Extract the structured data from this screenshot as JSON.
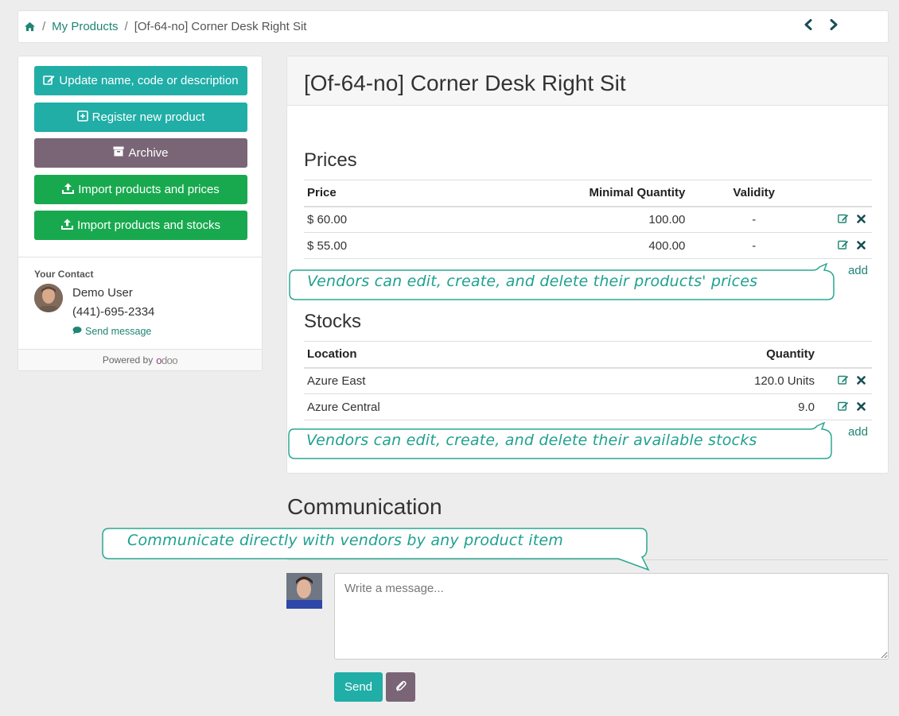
{
  "breadcrumb": {
    "home_icon": "home-icon",
    "items": [
      "My Products",
      "[Of-64-no] Corner Desk Right Sit"
    ],
    "separator": "/",
    "prev_icon": "chevron-left-icon",
    "next_icon": "chevron-right-icon"
  },
  "sidebar": {
    "buttons": [
      {
        "label": "Update name, code or description",
        "icon": "edit-icon",
        "color": "#20aea7"
      },
      {
        "label": "Register new product",
        "icon": "plus-square-icon",
        "color": "#20aea7"
      },
      {
        "label": "Archive",
        "icon": "archive-icon",
        "color": "#7a6577"
      },
      {
        "label": "Import products and prices",
        "icon": "upload-icon",
        "color": "#18a94f"
      },
      {
        "label": "Import products and stocks",
        "icon": "upload-icon",
        "color": "#18a94f"
      }
    ],
    "contact": {
      "label": "Your Contact",
      "name": "Demo User",
      "phone": "(441)-695-2334",
      "send_message": "Send message"
    },
    "powered_by": "Powered by",
    "logo_text": "odoo"
  },
  "product": {
    "title": "[Of-64-no] Corner Desk Right Sit"
  },
  "prices": {
    "title": "Prices",
    "columns": [
      "Price",
      "Minimal Quantity",
      "Validity"
    ],
    "rows": [
      {
        "price": "$ 60.00",
        "min_qty": "100.00",
        "validity": "-"
      },
      {
        "price": "$ 55.00",
        "min_qty": "400.00",
        "validity": "-"
      }
    ],
    "add_label": "add",
    "callout": "Vendors can edit, create, and delete their products' prices"
  },
  "stocks": {
    "title": "Stocks",
    "columns": [
      "Location",
      "Quantity"
    ],
    "rows": [
      {
        "location": "Azure East",
        "quantity": "120.0 Units"
      },
      {
        "location": "Azure Central",
        "quantity": "9.0"
      }
    ],
    "add_label": "add",
    "callout": "Vendors can edit, create, and delete their available stocks"
  },
  "communication": {
    "title": "Communication",
    "callout": "Communicate directly with vendors by any product item",
    "placeholder": "Write a message...",
    "send_label": "Send",
    "attach_icon": "paperclip-icon"
  },
  "colors": {
    "teal": "#20aea7",
    "mauve": "#7a6577",
    "green": "#18a94f",
    "link": "#1f8575",
    "callout_text": "#1fa18f"
  }
}
